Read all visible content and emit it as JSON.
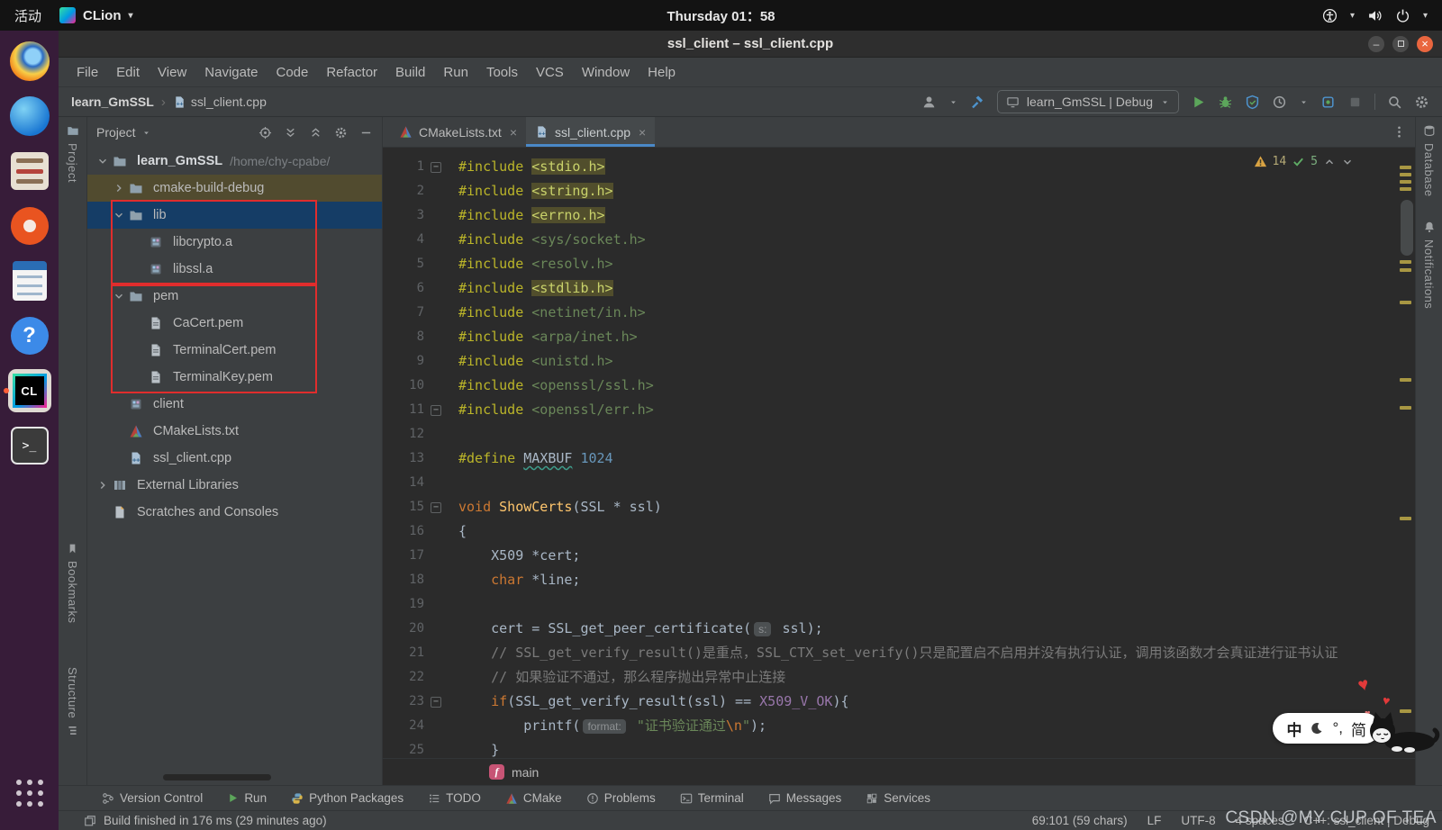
{
  "gnome_bar": {
    "activities_label": "活动",
    "app_menu_label": "CLion",
    "clock": "Thursday 01：58"
  },
  "dock": {
    "clion_glyph": "CL",
    "help_glyph": "?",
    "terminal_glyph": ">_"
  },
  "window": {
    "title": "ssl_client – ssl_client.cpp"
  },
  "menubar": {
    "items": [
      "File",
      "Edit",
      "View",
      "Navigate",
      "Code",
      "Refactor",
      "Build",
      "Run",
      "Tools",
      "VCS",
      "Window",
      "Help"
    ]
  },
  "navbar": {
    "crumb_project": "learn_GmSSL",
    "crumb_sep": "›",
    "crumb_file": "ssl_client.cpp",
    "run_config": "learn_GmSSL | Debug"
  },
  "left_stripe": {
    "project": "Project",
    "bookmarks": "Bookmarks",
    "structure": "Structure"
  },
  "right_stripe": {
    "database": "Database",
    "notifications": "Notifications"
  },
  "project_panel": {
    "header": "Project",
    "items": {
      "root": "learn_GmSSL",
      "root_path": "/home/chy-cpabe/",
      "cmake_build": "cmake-build-debug",
      "lib": "lib",
      "libcrypto": "libcrypto.a",
      "libssl": "libssl.a",
      "pem": "pem",
      "cacert": "CaCert.pem",
      "terminalcert": "TerminalCert.pem",
      "terminalkey": "TerminalKey.pem",
      "client": "client",
      "cmakelists": "CMakeLists.txt",
      "sslclient": "ssl_client.cpp",
      "external": "External Libraries",
      "scratches": "Scratches and Consoles"
    }
  },
  "editor": {
    "tabs": [
      {
        "label": "CMakeLists.txt"
      },
      {
        "label": "ssl_client.cpp"
      }
    ],
    "close_glyph": "×",
    "inspections": {
      "warnings": "14",
      "ok": "5"
    },
    "breadcrumb": {
      "badge": "f",
      "label": "main"
    },
    "stripe_marks": [
      20,
      28,
      36,
      44,
      125,
      134,
      170,
      256,
      287,
      410,
      624
    ],
    "code_lines": [
      {
        "n": "1",
        "fold": true,
        "t": [
          [
            "directive",
            "#include "
          ],
          [
            "header-hl",
            "<stdio.h>"
          ]
        ]
      },
      {
        "n": "2",
        "t": [
          [
            "directive",
            "#include "
          ],
          [
            "header-hl",
            "<string.h>"
          ]
        ]
      },
      {
        "n": "3",
        "t": [
          [
            "directive",
            "#include "
          ],
          [
            "header-hl",
            "<errno.h>"
          ]
        ]
      },
      {
        "n": "4",
        "t": [
          [
            "directive",
            "#include "
          ],
          [
            "header",
            "<sys/socket.h>"
          ]
        ]
      },
      {
        "n": "5",
        "t": [
          [
            "directive",
            "#include "
          ],
          [
            "header",
            "<resolv.h>"
          ]
        ]
      },
      {
        "n": "6",
        "t": [
          [
            "directive",
            "#include "
          ],
          [
            "header-hl",
            "<stdlib.h>"
          ]
        ]
      },
      {
        "n": "7",
        "t": [
          [
            "directive",
            "#include "
          ],
          [
            "header",
            "<netinet/in.h>"
          ]
        ]
      },
      {
        "n": "8",
        "t": [
          [
            "directive",
            "#include "
          ],
          [
            "header",
            "<arpa/inet.h>"
          ]
        ]
      },
      {
        "n": "9",
        "t": [
          [
            "directive",
            "#include "
          ],
          [
            "header",
            "<unistd.h>"
          ]
        ]
      },
      {
        "n": "10",
        "t": [
          [
            "directive",
            "#include "
          ],
          [
            "header",
            "<openssl/ssl.h>"
          ]
        ]
      },
      {
        "n": "11",
        "fold": true,
        "t": [
          [
            "directive",
            "#include "
          ],
          [
            "header",
            "<openssl/err.h>"
          ]
        ]
      },
      {
        "n": "12",
        "t": []
      },
      {
        "n": "13",
        "t": [
          [
            "directive",
            "#define "
          ],
          [
            "macro",
            "MAXBUF"
          ],
          [
            "plain",
            " "
          ],
          [
            "number",
            "1024"
          ]
        ]
      },
      {
        "n": "14",
        "t": []
      },
      {
        "n": "15",
        "fold": true,
        "t": [
          [
            "keyword",
            "void "
          ],
          [
            "function",
            "ShowCerts"
          ],
          [
            "plain",
            "(SSL * ssl)"
          ]
        ]
      },
      {
        "n": "16",
        "t": [
          [
            "plain",
            "{"
          ]
        ]
      },
      {
        "n": "17",
        "t": [
          [
            "plain",
            "    X509 *cert;"
          ]
        ]
      },
      {
        "n": "18",
        "t": [
          [
            "plain",
            "    "
          ],
          [
            "keyword",
            "char"
          ],
          [
            "plain",
            " *line;"
          ]
        ]
      },
      {
        "n": "19",
        "t": []
      },
      {
        "n": "20",
        "t": [
          [
            "plain",
            "    cert = SSL_get_peer_certificate("
          ],
          [
            "hint",
            "s:"
          ],
          [
            "plain",
            " ssl);"
          ]
        ]
      },
      {
        "n": "21",
        "t": [
          [
            "comment",
            "    // SSL_get_verify_result()是重点，SSL_CTX_set_verify()只是配置启不启用并没有执行认证，调用该函数才会真证进行证书认证"
          ]
        ]
      },
      {
        "n": "22",
        "t": [
          [
            "comment",
            "    // 如果验证不通过，那么程序抛出异常中止连接"
          ]
        ]
      },
      {
        "n": "23",
        "fold": true,
        "t": [
          [
            "plain",
            "    "
          ],
          [
            "keyword",
            "if"
          ],
          [
            "plain",
            "(SSL_get_verify_result(ssl) == "
          ],
          [
            "constant",
            "X509_V_OK"
          ],
          [
            "plain",
            "){"
          ]
        ]
      },
      {
        "n": "24",
        "t": [
          [
            "plain",
            "        printf("
          ],
          [
            "hint",
            "format:"
          ],
          [
            "plain",
            " "
          ],
          [
            "string",
            "\"证书验证通过"
          ],
          [
            "escape",
            "\\n"
          ],
          [
            "string",
            "\""
          ],
          [
            "plain",
            ");"
          ]
        ]
      },
      {
        "n": "25",
        "t": [
          [
            "plain",
            "    }"
          ]
        ]
      }
    ]
  },
  "toolwindow_bar": {
    "items": [
      "Version Control",
      "Run",
      "Python Packages",
      "TODO",
      "CMake",
      "Problems",
      "Terminal",
      "Messages",
      "Services"
    ]
  },
  "status_bar": {
    "message": "Build finished in 176 ms (29 minutes ago)",
    "caret": "69:101 (59 chars)",
    "line_ending": "LF",
    "encoding": "UTF-8",
    "indent": "4 spaces",
    "context": "C++: ssl_client | Debug"
  },
  "overlays": {
    "watermark": "CSDN @MY CUP OF TEA",
    "ime": {
      "lang": "中",
      "punct": "°,",
      "charset": "简"
    }
  },
  "colors": {
    "editor_bg": "#2B2B2B",
    "panel_bg": "#3C3F41",
    "selection_blue": "#153D66",
    "occurrence_olive": "#514B2F",
    "tab_accent": "#4A88C7",
    "warning_yellow": "#D9A343",
    "ok_green": "#5FAD65",
    "annotation_red": "#E02D2D",
    "dock_purple": "#371C39"
  }
}
